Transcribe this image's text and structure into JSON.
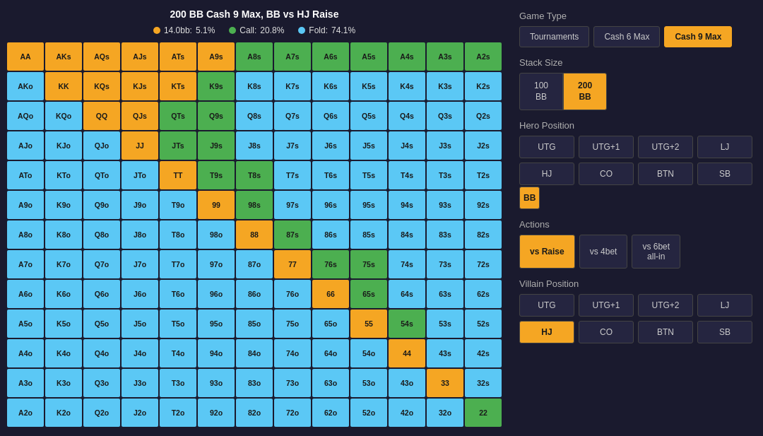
{
  "title": "200 BB Cash 9 Max, BB vs HJ Raise",
  "legend": {
    "raise": {
      "label": "14.0bb:",
      "pct": "5.1%",
      "color": "#f5a623"
    },
    "call": {
      "label": "Call:",
      "pct": "20.8%",
      "color": "#4caf50"
    },
    "fold": {
      "label": "Fold:",
      "pct": "74.1%",
      "color": "#5bc8f5"
    }
  },
  "gameType": {
    "label": "Game Type",
    "options": [
      "Tournaments",
      "Cash 6 Max",
      "Cash 9 Max"
    ],
    "active": "Cash 9 Max"
  },
  "stackSize": {
    "label": "Stack Size",
    "options": [
      {
        "label": "100\nBB",
        "value": "100"
      },
      {
        "label": "200\nBB",
        "value": "200"
      }
    ],
    "active": "200"
  },
  "heroPosition": {
    "label": "Hero Position",
    "positions": [
      "UTG",
      "UTG+1",
      "UTG+2",
      "LJ",
      "HJ",
      "CO",
      "BTN",
      "SB",
      "BB"
    ],
    "active": "BB"
  },
  "actions": {
    "label": "Actions",
    "options": [
      "vs Raise",
      "vs 4bet",
      "vs 6bet\nall-in"
    ],
    "active": "vs Raise"
  },
  "villainPosition": {
    "label": "Villain Position",
    "positions": [
      "UTG",
      "UTG+1",
      "UTG+2",
      "LJ",
      "HJ",
      "CO",
      "BTN",
      "SB"
    ],
    "active": "HJ",
    "active2": "CO"
  },
  "grid": {
    "rows": [
      [
        {
          "t": "AA",
          "c": "orange"
        },
        {
          "t": "AKs",
          "c": "orange"
        },
        {
          "t": "AQs",
          "c": "orange"
        },
        {
          "t": "AJs",
          "c": "orange"
        },
        {
          "t": "ATs",
          "c": "orange"
        },
        {
          "t": "A9s",
          "c": "orange"
        },
        {
          "t": "A8s",
          "c": "green"
        },
        {
          "t": "A7s",
          "c": "green"
        },
        {
          "t": "A6s",
          "c": "green"
        },
        {
          "t": "A5s",
          "c": "green"
        },
        {
          "t": "A4s",
          "c": "green"
        },
        {
          "t": "A3s",
          "c": "green"
        },
        {
          "t": "A2s",
          "c": "green"
        }
      ],
      [
        {
          "t": "AKo",
          "c": "blue"
        },
        {
          "t": "KK",
          "c": "orange"
        },
        {
          "t": "KQs",
          "c": "orange"
        },
        {
          "t": "KJs",
          "c": "orange"
        },
        {
          "t": "KTs",
          "c": "orange"
        },
        {
          "t": "K9s",
          "c": "green"
        },
        {
          "t": "K8s",
          "c": "blue"
        },
        {
          "t": "K7s",
          "c": "blue"
        },
        {
          "t": "K6s",
          "c": "blue"
        },
        {
          "t": "K5s",
          "c": "blue"
        },
        {
          "t": "K4s",
          "c": "blue"
        },
        {
          "t": "K3s",
          "c": "blue"
        },
        {
          "t": "K2s",
          "c": "blue"
        }
      ],
      [
        {
          "t": "AQo",
          "c": "blue"
        },
        {
          "t": "KQo",
          "c": "blue"
        },
        {
          "t": "QQ",
          "c": "orange"
        },
        {
          "t": "QJs",
          "c": "orange"
        },
        {
          "t": "QTs",
          "c": "green"
        },
        {
          "t": "Q9s",
          "c": "green"
        },
        {
          "t": "Q8s",
          "c": "blue"
        },
        {
          "t": "Q7s",
          "c": "blue"
        },
        {
          "t": "Q6s",
          "c": "blue"
        },
        {
          "t": "Q5s",
          "c": "blue"
        },
        {
          "t": "Q4s",
          "c": "blue"
        },
        {
          "t": "Q3s",
          "c": "blue"
        },
        {
          "t": "Q2s",
          "c": "blue"
        }
      ],
      [
        {
          "t": "AJo",
          "c": "blue"
        },
        {
          "t": "KJo",
          "c": "blue"
        },
        {
          "t": "QJo",
          "c": "blue"
        },
        {
          "t": "JJ",
          "c": "orange"
        },
        {
          "t": "JTs",
          "c": "green"
        },
        {
          "t": "J9s",
          "c": "green"
        },
        {
          "t": "J8s",
          "c": "blue"
        },
        {
          "t": "J7s",
          "c": "blue"
        },
        {
          "t": "J6s",
          "c": "blue"
        },
        {
          "t": "J5s",
          "c": "blue"
        },
        {
          "t": "J4s",
          "c": "blue"
        },
        {
          "t": "J3s",
          "c": "blue"
        },
        {
          "t": "J2s",
          "c": "blue"
        }
      ],
      [
        {
          "t": "ATo",
          "c": "blue"
        },
        {
          "t": "KTo",
          "c": "blue"
        },
        {
          "t": "QTo",
          "c": "blue"
        },
        {
          "t": "JTo",
          "c": "blue"
        },
        {
          "t": "TT",
          "c": "orange"
        },
        {
          "t": "T9s",
          "c": "green"
        },
        {
          "t": "T8s",
          "c": "green"
        },
        {
          "t": "T7s",
          "c": "blue"
        },
        {
          "t": "T6s",
          "c": "blue"
        },
        {
          "t": "T5s",
          "c": "blue"
        },
        {
          "t": "T4s",
          "c": "blue"
        },
        {
          "t": "T3s",
          "c": "blue"
        },
        {
          "t": "T2s",
          "c": "blue"
        }
      ],
      [
        {
          "t": "A9o",
          "c": "blue"
        },
        {
          "t": "K9o",
          "c": "blue"
        },
        {
          "t": "Q9o",
          "c": "blue"
        },
        {
          "t": "J9o",
          "c": "blue"
        },
        {
          "t": "T9o",
          "c": "blue"
        },
        {
          "t": "99",
          "c": "orange"
        },
        {
          "t": "98s",
          "c": "green"
        },
        {
          "t": "97s",
          "c": "blue"
        },
        {
          "t": "96s",
          "c": "blue"
        },
        {
          "t": "95s",
          "c": "blue"
        },
        {
          "t": "94s",
          "c": "blue"
        },
        {
          "t": "93s",
          "c": "blue"
        },
        {
          "t": "92s",
          "c": "blue"
        }
      ],
      [
        {
          "t": "A8o",
          "c": "blue"
        },
        {
          "t": "K8o",
          "c": "blue"
        },
        {
          "t": "Q8o",
          "c": "blue"
        },
        {
          "t": "J8o",
          "c": "blue"
        },
        {
          "t": "T8o",
          "c": "blue"
        },
        {
          "t": "98o",
          "c": "blue"
        },
        {
          "t": "88",
          "c": "orange"
        },
        {
          "t": "87s",
          "c": "green"
        },
        {
          "t": "86s",
          "c": "blue"
        },
        {
          "t": "85s",
          "c": "blue"
        },
        {
          "t": "84s",
          "c": "blue"
        },
        {
          "t": "83s",
          "c": "blue"
        },
        {
          "t": "82s",
          "c": "blue"
        }
      ],
      [
        {
          "t": "A7o",
          "c": "blue"
        },
        {
          "t": "K7o",
          "c": "blue"
        },
        {
          "t": "Q7o",
          "c": "blue"
        },
        {
          "t": "J7o",
          "c": "blue"
        },
        {
          "t": "T7o",
          "c": "blue"
        },
        {
          "t": "97o",
          "c": "blue"
        },
        {
          "t": "87o",
          "c": "blue"
        },
        {
          "t": "77",
          "c": "orange"
        },
        {
          "t": "76s",
          "c": "green"
        },
        {
          "t": "75s",
          "c": "green"
        },
        {
          "t": "74s",
          "c": "blue"
        },
        {
          "t": "73s",
          "c": "blue"
        },
        {
          "t": "72s",
          "c": "blue"
        }
      ],
      [
        {
          "t": "A6o",
          "c": "blue"
        },
        {
          "t": "K6o",
          "c": "blue"
        },
        {
          "t": "Q6o",
          "c": "blue"
        },
        {
          "t": "J6o",
          "c": "blue"
        },
        {
          "t": "T6o",
          "c": "blue"
        },
        {
          "t": "96o",
          "c": "blue"
        },
        {
          "t": "86o",
          "c": "blue"
        },
        {
          "t": "76o",
          "c": "blue"
        },
        {
          "t": "66",
          "c": "orange"
        },
        {
          "t": "65s",
          "c": "green"
        },
        {
          "t": "64s",
          "c": "blue"
        },
        {
          "t": "63s",
          "c": "blue"
        },
        {
          "t": "62s",
          "c": "blue"
        }
      ],
      [
        {
          "t": "A5o",
          "c": "blue"
        },
        {
          "t": "K5o",
          "c": "blue"
        },
        {
          "t": "Q5o",
          "c": "blue"
        },
        {
          "t": "J5o",
          "c": "blue"
        },
        {
          "t": "T5o",
          "c": "blue"
        },
        {
          "t": "95o",
          "c": "blue"
        },
        {
          "t": "85o",
          "c": "blue"
        },
        {
          "t": "75o",
          "c": "blue"
        },
        {
          "t": "65o",
          "c": "blue"
        },
        {
          "t": "55",
          "c": "orange"
        },
        {
          "t": "54s",
          "c": "green"
        },
        {
          "t": "53s",
          "c": "blue"
        },
        {
          "t": "52s",
          "c": "blue"
        }
      ],
      [
        {
          "t": "A4o",
          "c": "blue"
        },
        {
          "t": "K4o",
          "c": "blue"
        },
        {
          "t": "Q4o",
          "c": "blue"
        },
        {
          "t": "J4o",
          "c": "blue"
        },
        {
          "t": "T4o",
          "c": "blue"
        },
        {
          "t": "94o",
          "c": "blue"
        },
        {
          "t": "84o",
          "c": "blue"
        },
        {
          "t": "74o",
          "c": "blue"
        },
        {
          "t": "64o",
          "c": "blue"
        },
        {
          "t": "54o",
          "c": "blue"
        },
        {
          "t": "44",
          "c": "orange"
        },
        {
          "t": "43s",
          "c": "blue"
        },
        {
          "t": "42s",
          "c": "blue"
        }
      ],
      [
        {
          "t": "A3o",
          "c": "blue"
        },
        {
          "t": "K3o",
          "c": "blue"
        },
        {
          "t": "Q3o",
          "c": "blue"
        },
        {
          "t": "J3o",
          "c": "blue"
        },
        {
          "t": "T3o",
          "c": "blue"
        },
        {
          "t": "93o",
          "c": "blue"
        },
        {
          "t": "83o",
          "c": "blue"
        },
        {
          "t": "73o",
          "c": "blue"
        },
        {
          "t": "63o",
          "c": "blue"
        },
        {
          "t": "53o",
          "c": "blue"
        },
        {
          "t": "43o",
          "c": "blue"
        },
        {
          "t": "33",
          "c": "orange"
        },
        {
          "t": "32s",
          "c": "blue"
        }
      ],
      [
        {
          "t": "A2o",
          "c": "blue"
        },
        {
          "t": "K2o",
          "c": "blue"
        },
        {
          "t": "Q2o",
          "c": "blue"
        },
        {
          "t": "J2o",
          "c": "blue"
        },
        {
          "t": "T2o",
          "c": "blue"
        },
        {
          "t": "92o",
          "c": "blue"
        },
        {
          "t": "82o",
          "c": "blue"
        },
        {
          "t": "72o",
          "c": "blue"
        },
        {
          "t": "62o",
          "c": "blue"
        },
        {
          "t": "52o",
          "c": "blue"
        },
        {
          "t": "42o",
          "c": "blue"
        },
        {
          "t": "32o",
          "c": "blue"
        },
        {
          "t": "22",
          "c": "green"
        }
      ]
    ]
  }
}
